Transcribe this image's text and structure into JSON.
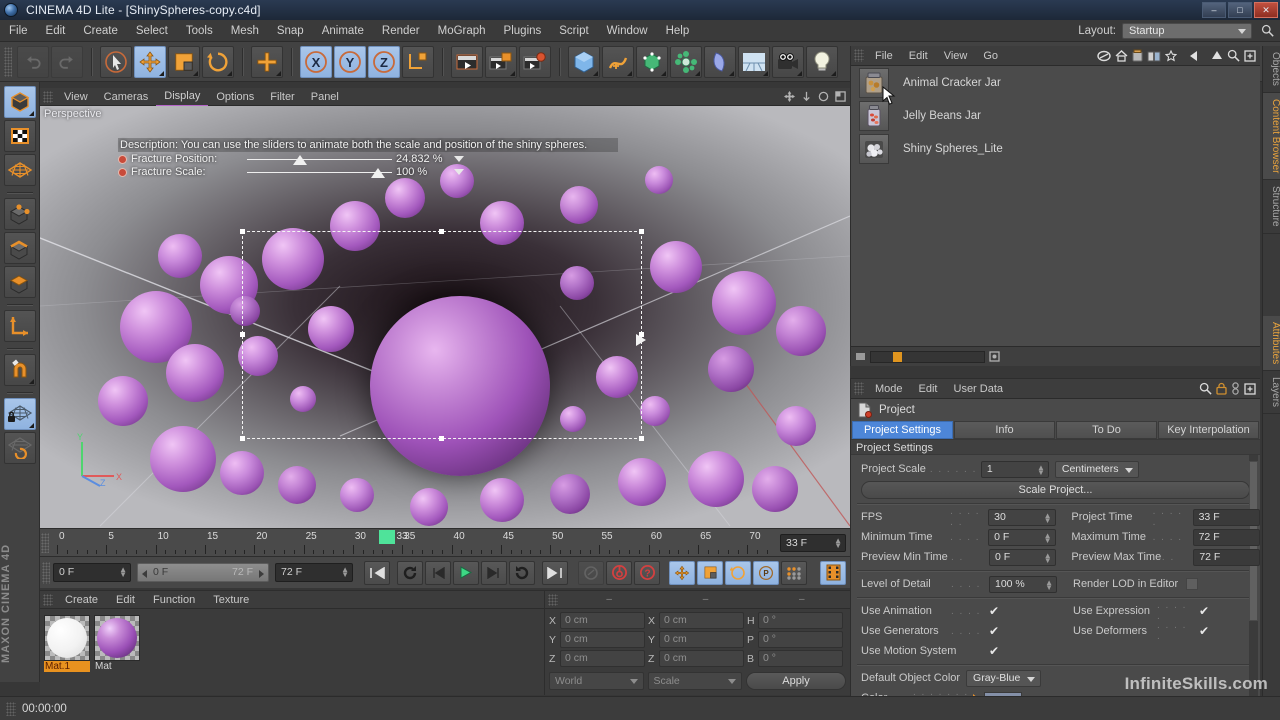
{
  "titlebar": {
    "app_title": "CINEMA 4D Lite - [ShinySpheres-copy.c4d]",
    "icon": "c4d-logo-icon",
    "minimize": "–",
    "maximize": "□",
    "close": "✕"
  },
  "menubar": {
    "items": [
      {
        "label": "File"
      },
      {
        "label": "Edit"
      },
      {
        "label": "Create"
      },
      {
        "label": "Select"
      },
      {
        "label": "Tools"
      },
      {
        "label": "Mesh"
      },
      {
        "label": "Snap"
      },
      {
        "label": "Animate"
      },
      {
        "label": "Render"
      },
      {
        "label": "MoGraph"
      },
      {
        "label": "Plugins"
      },
      {
        "label": "Script"
      },
      {
        "label": "Window"
      },
      {
        "label": "Help"
      }
    ],
    "layout_label": "Layout:",
    "layout_value": "Startup",
    "search_icon": "search-icon"
  },
  "toolbar": {
    "buttons": [
      {
        "name": "undo-icon"
      },
      {
        "name": "redo-icon"
      },
      {
        "name": "select-live-icon"
      },
      {
        "name": "move-icon"
      },
      {
        "name": "scale-icon"
      },
      {
        "name": "rotate-icon"
      },
      {
        "name": "add-icon"
      },
      {
        "name": "x-axis-icon",
        "label": "X"
      },
      {
        "name": "y-axis-icon",
        "label": "Y"
      },
      {
        "name": "z-axis-icon",
        "label": "Z"
      },
      {
        "name": "world-coord-icon"
      },
      {
        "name": "render-view-icon"
      },
      {
        "name": "render-region-icon"
      },
      {
        "name": "render-settings-icon"
      },
      {
        "name": "cube-primitive-icon"
      },
      {
        "name": "spline-icon"
      },
      {
        "name": "nurbs-icon"
      },
      {
        "name": "mograph-array-icon"
      },
      {
        "name": "deformer-icon"
      },
      {
        "name": "scene-floor-icon"
      },
      {
        "name": "camera-icon"
      },
      {
        "name": "light-icon"
      }
    ]
  },
  "lefttools": {
    "buttons": [
      {
        "name": "object-mode-icon"
      },
      {
        "name": "texture-mode-icon"
      },
      {
        "name": "points-mode-icon"
      },
      {
        "name": "point-mode-icon"
      },
      {
        "name": "edge-mode-icon"
      },
      {
        "name": "polygon-mode-icon"
      },
      {
        "name": "axis-mode-icon"
      },
      {
        "name": "magnet-tool-icon"
      },
      {
        "name": "workplane-lock-icon"
      },
      {
        "name": "workplane-icon"
      }
    ],
    "brand": "MAXON CINEMA 4D"
  },
  "viewport": {
    "menus": [
      {
        "label": "View"
      },
      {
        "label": "Cameras"
      },
      {
        "label": "Display",
        "active": true
      },
      {
        "label": "Options"
      },
      {
        "label": "Filter"
      },
      {
        "label": "Panel"
      }
    ],
    "corner_label": "Perspective",
    "hud": {
      "description": "Description: You can use the sliders to animate both the scale and position of the shiny spheres.",
      "rows": [
        {
          "label": "Fracture Position:",
          "value": "24.832 %",
          "knob_pct": 36
        },
        {
          "label": "Fracture Scale:",
          "value": "100 %",
          "knob_pct": 92
        }
      ]
    }
  },
  "timeline": {
    "labels": [
      "0",
      "5",
      "10",
      "15",
      "20",
      "25",
      "30",
      "35",
      "40",
      "45",
      "50",
      "55",
      "60",
      "65",
      "70"
    ],
    "min_frame": 0,
    "max_frame": 73,
    "playhead_frame": 33,
    "playhead_label": "33",
    "current_field": "33 F"
  },
  "transport": {
    "current_frame": "0 F",
    "range_start": "0 F",
    "range_end": "72 F",
    "end_frame": "72 F",
    "buttons": [
      {
        "name": "go-to-start-button",
        "glyph": "⏮"
      },
      {
        "name": "loop-button",
        "glyph": "↺"
      },
      {
        "name": "step-back-button",
        "glyph": "⏴"
      },
      {
        "name": "play-button",
        "glyph": "▶"
      },
      {
        "name": "step-forward-button",
        "glyph": "⏵"
      },
      {
        "name": "revert-button",
        "glyph": "↻"
      },
      {
        "name": "go-to-end-button",
        "glyph": "⏭"
      },
      {
        "name": "autokey-record-icon"
      },
      {
        "name": "record-keyframe-button"
      },
      {
        "name": "key-help-button"
      },
      {
        "name": "key-position-button"
      },
      {
        "name": "key-scale-button"
      },
      {
        "name": "key-rotation-button"
      },
      {
        "name": "key-param-button"
      },
      {
        "name": "key-point-button"
      },
      {
        "name": "timeline-toggle-button"
      }
    ]
  },
  "materials": {
    "menus": [
      {
        "label": "Create"
      },
      {
        "label": "Edit"
      },
      {
        "label": "Function"
      },
      {
        "label": "Texture"
      }
    ],
    "items": [
      {
        "name": "Mat.1",
        "selected": true,
        "color": "#ffffff"
      },
      {
        "name": "Mat",
        "selected": false,
        "color": "#a05cc0"
      }
    ]
  },
  "coordinates": {
    "headers": [
      "–",
      "–",
      "–"
    ],
    "rows": [
      {
        "a1": "X",
        "v1": "0 cm",
        "a2": "X",
        "v2": "0 cm",
        "a3": "H",
        "v3": "0 °"
      },
      {
        "a1": "Y",
        "v1": "0 cm",
        "a2": "Y",
        "v2": "0 cm",
        "a3": "P",
        "v3": "0 °"
      },
      {
        "a1": "Z",
        "v1": "0 cm",
        "a2": "Z",
        "v2": "0 cm",
        "a3": "B",
        "v3": "0 °"
      }
    ],
    "space": "World",
    "mode": "Scale",
    "apply": "Apply"
  },
  "content_browser": {
    "menus": [
      {
        "label": "File"
      },
      {
        "label": "Edit"
      },
      {
        "label": "View"
      },
      {
        "label": "Go"
      }
    ],
    "tools": [
      {
        "name": "preset-icon"
      },
      {
        "name": "home-icon"
      },
      {
        "name": "content-jar-icon"
      },
      {
        "name": "library-icon"
      },
      {
        "name": "favorites-star-icon"
      },
      {
        "name": "back-icon"
      },
      {
        "name": "up-icon"
      },
      {
        "name": "search-icon"
      },
      {
        "name": "new-folder-icon"
      }
    ],
    "items": [
      {
        "label": "Animal Cracker Jar",
        "thumb": "animal-cracker-jar-thumb"
      },
      {
        "label": "Jelly Beans Jar",
        "thumb": "jelly-beans-jar-thumb"
      },
      {
        "label": "Shiny Spheres_Lite",
        "thumb": "shiny-spheres-thumb"
      }
    ]
  },
  "attributes": {
    "menus": [
      {
        "label": "Mode"
      },
      {
        "label": "Edit"
      },
      {
        "label": "User Data"
      }
    ],
    "tools": [
      {
        "name": "search-icon"
      },
      {
        "name": "lock-icon"
      },
      {
        "name": "link-icon"
      },
      {
        "name": "expand-icon"
      }
    ],
    "object_name": "Project",
    "object_icon": "project-icon",
    "tabs": [
      {
        "label": "Project Settings",
        "active": true
      },
      {
        "label": "Info",
        "active": false
      },
      {
        "label": "To Do",
        "active": false
      },
      {
        "label": "Key Interpolation",
        "active": false
      }
    ],
    "section_title": "Project Settings",
    "project_scale_label": "Project Scale",
    "project_scale_value": "1",
    "project_scale_unit": "Centimeters",
    "scale_project_button": "Scale Project...",
    "fields_left": [
      {
        "label": "FPS",
        "value": "30"
      },
      {
        "label": "Minimum Time",
        "value": "0 F"
      },
      {
        "label": "Preview Min Time",
        "value": "0 F"
      }
    ],
    "fields_right": [
      {
        "label": "Project Time",
        "value": "33 F"
      },
      {
        "label": "Maximum Time",
        "value": "72 F"
      },
      {
        "label": "Preview Max Time",
        "value": "72 F"
      }
    ],
    "lod_label": "Level of Detail",
    "lod_value": "100 %",
    "render_lod_label": "Render LOD in Editor",
    "checks_left": [
      {
        "label": "Use Animation",
        "checked": true
      },
      {
        "label": "Use Generators",
        "checked": true
      },
      {
        "label": "Use Motion System",
        "checked": true
      }
    ],
    "checks_right": [
      {
        "label": "Use Expression",
        "checked": true
      },
      {
        "label": "Use Deformers",
        "checked": true
      }
    ],
    "default_object_color_label": "Default Object Color",
    "default_object_color_value": "Gray-Blue",
    "color_label": "Color",
    "color_swatch": "#8490a8"
  },
  "vtabs": [
    {
      "label": "Objects",
      "active": false
    },
    {
      "label": "Content Browser",
      "active": true
    },
    {
      "label": "Structure",
      "active": false
    },
    {
      "label": "Attributes",
      "active": true
    },
    {
      "label": "Layers",
      "active": false
    }
  ],
  "status": {
    "time": "00:00:00"
  },
  "watermark": "InfiniteSkills.com"
}
